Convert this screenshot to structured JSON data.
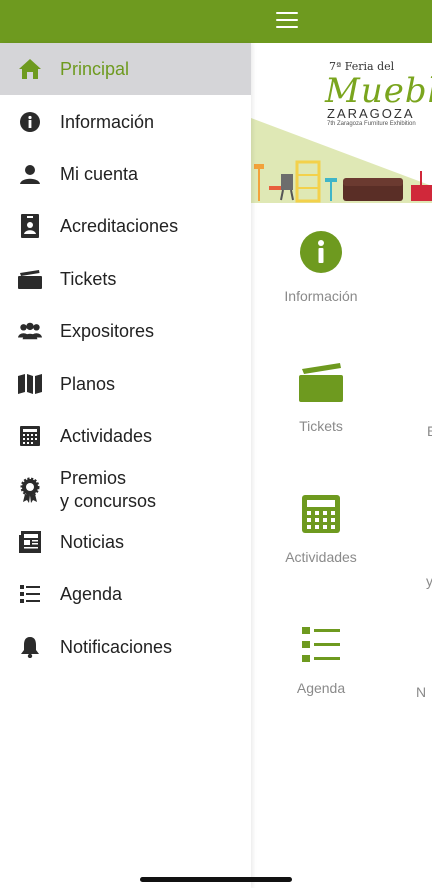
{
  "colors": {
    "brand": "#6e9a1f",
    "active_bg": "#d5d5d8",
    "icon_dark": "#2b2b2b"
  },
  "header": {
    "menu_icon": "hamburger-icon"
  },
  "banner": {
    "line1": "7ª Feria del",
    "line2": "Mueble",
    "line3": "ZARAGOZA",
    "line4": "7th Zaragoza Furniture Exhibition"
  },
  "sidebar": {
    "items": [
      {
        "label": "Principal",
        "icon": "home-icon",
        "active": true
      },
      {
        "label": "Información",
        "icon": "info-icon"
      },
      {
        "label": "Mi cuenta",
        "icon": "user-icon"
      },
      {
        "label": "Acreditaciones",
        "icon": "badge-icon"
      },
      {
        "label": "Tickets",
        "icon": "ticket-icon"
      },
      {
        "label": "Expositores",
        "icon": "group-icon"
      },
      {
        "label": "Planos",
        "icon": "map-icon"
      },
      {
        "label": "Actividades",
        "icon": "calendar-icon"
      },
      {
        "label_line1": "Premios",
        "label_line2": "y concursos",
        "icon": "award-icon"
      },
      {
        "label": "Noticias",
        "icon": "newspaper-icon"
      },
      {
        "label": "Agenda",
        "icon": "list-icon"
      },
      {
        "label": "Notificaciones",
        "icon": "bell-icon"
      }
    ]
  },
  "tiles": [
    {
      "label": "Información",
      "icon": "info-circle-icon"
    },
    {
      "label": "Tickets",
      "icon": "ticket-icon"
    },
    {
      "label": "Actividades",
      "icon": "calendar-icon"
    },
    {
      "label": "Agenda",
      "icon": "list-icon"
    }
  ],
  "tile_edges": [
    "E",
    "y",
    "N"
  ]
}
